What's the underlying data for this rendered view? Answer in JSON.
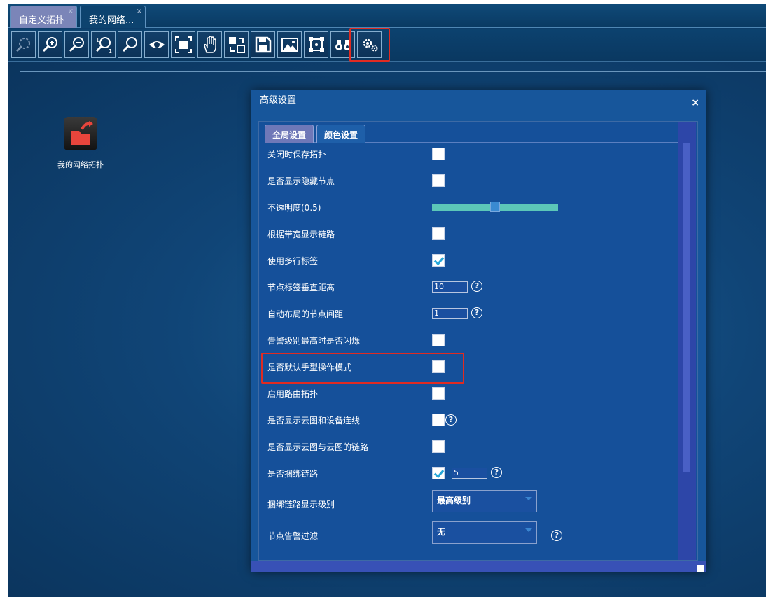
{
  "tabs": [
    {
      "label": "自定义拓扑",
      "close": "×"
    },
    {
      "label": "我的网络...",
      "close": "×"
    }
  ],
  "toolbar": {
    "buttons": [
      "zoom-reset",
      "zoom-in",
      "zoom-out",
      "zoom-1-1",
      "search",
      "eye",
      "fit-screen",
      "hand-pan",
      "layout",
      "save",
      "image-export",
      "select-area",
      "binoculars",
      "settings"
    ]
  },
  "node": {
    "label": "我的网络拓扑"
  },
  "dialog": {
    "title": "高级设置",
    "close": "×",
    "tabs": [
      "全局设置",
      "颜色设置"
    ],
    "rows": {
      "r0": "关闭时保存拓扑",
      "r1": "是否显示隐藏节点",
      "r2": "不透明度(0.5)",
      "r3": "根据带宽显示链路",
      "r4": "使用多行标签",
      "r5": "节点标签垂直距离",
      "r6": "自动布局的节点间距",
      "r7": "告警级别最高时是否闪烁",
      "r8": "是否默认手型操作模式",
      "r9": "启用路由拓扑",
      "r10": "是否显示云图和设备连线",
      "r11": "是否显示云图与云图的链路",
      "r12": "是否捆绑链路",
      "r13": "捆绑链路显示级别",
      "r14": "节点告警过滤"
    },
    "values": {
      "opacity": 0.5,
      "label_distance": "10",
      "node_spacing": "1",
      "bundle_count": "5",
      "bundle_level": "最高级别",
      "alarm_filter": "无"
    },
    "help_glyph": "?"
  }
}
